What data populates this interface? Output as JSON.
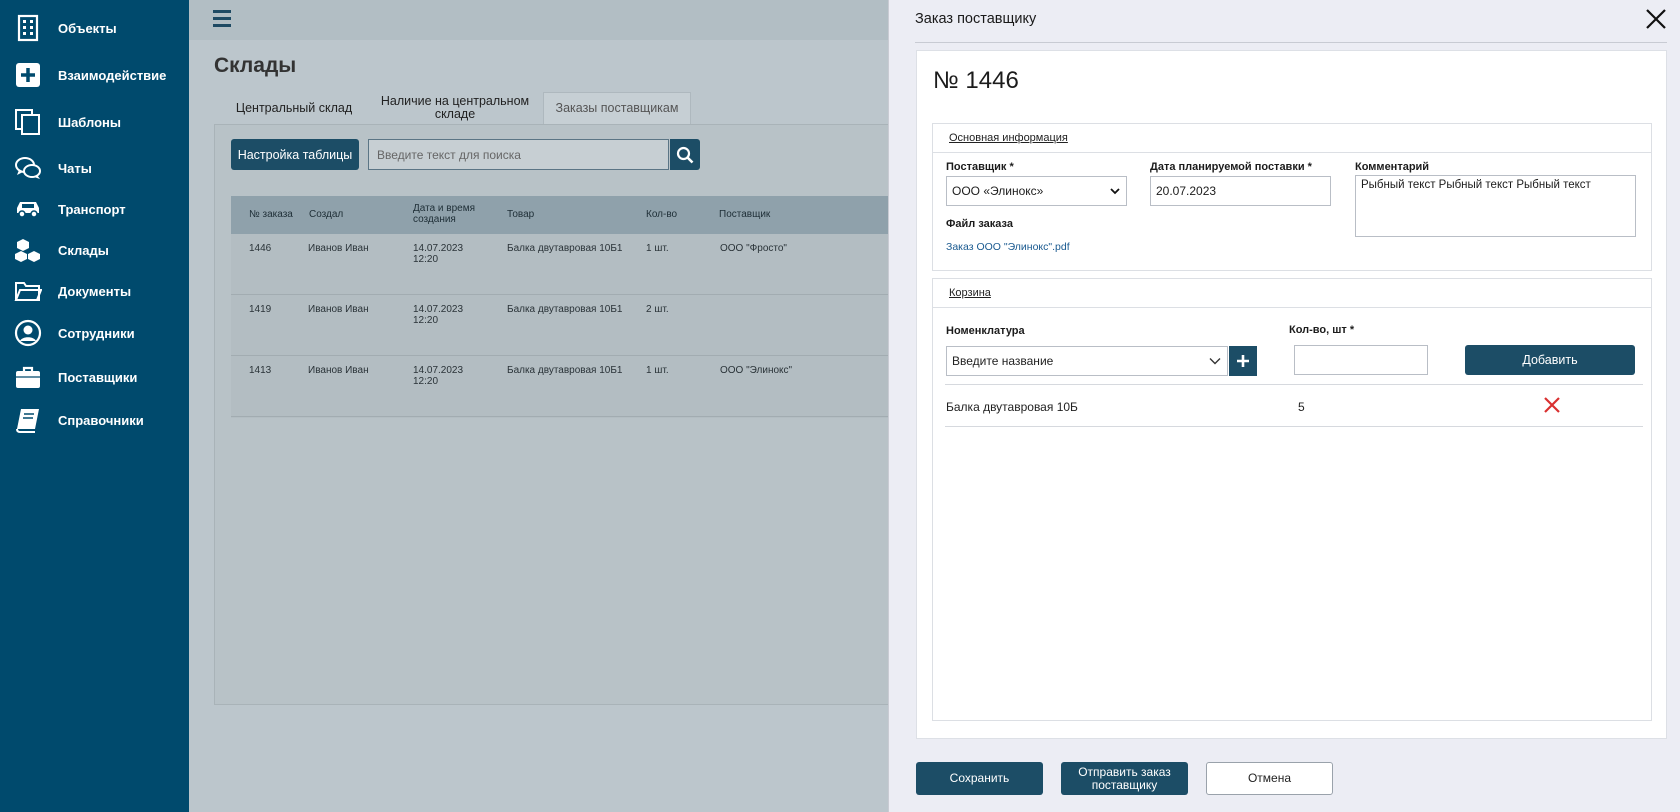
{
  "sidebar": {
    "items": [
      {
        "label": "Объекты",
        "icon": "building-icon"
      },
      {
        "label": "Взаимодействие",
        "icon": "plus-square-icon"
      },
      {
        "label": "Шаблоны",
        "icon": "copy-icon"
      },
      {
        "label": "Чаты",
        "icon": "chat-icon"
      },
      {
        "label": "Транспорт",
        "icon": "car-icon"
      },
      {
        "label": "Склады",
        "icon": "boxes-icon"
      },
      {
        "label": "Документы",
        "icon": "folder-icon"
      },
      {
        "label": "Сотрудники",
        "icon": "user-icon"
      },
      {
        "label": "Поставщики",
        "icon": "briefcase-icon"
      },
      {
        "label": "Справочники",
        "icon": "book-icon"
      }
    ]
  },
  "main": {
    "title": "Склады",
    "tabs": [
      {
        "label": "Центральный склад",
        "active": false
      },
      {
        "label": "Наличие на центральном складе",
        "active": false
      },
      {
        "label": "Заказы поставщикам",
        "active": true
      }
    ],
    "config_button": "Настройка таблицы",
    "search_placeholder": "Введите текст для поиска",
    "table": {
      "columns": [
        "№ заказа",
        "Создал",
        "Дата и время создания",
        "Товар",
        "Кол-во",
        "Поставщик"
      ],
      "rows": [
        {
          "id": "1446",
          "creator": "Иванов Иван",
          "date": "14.07.2023",
          "time": "12:20",
          "product": "Балка двутавровая 10Б1",
          "qty": "1 шт.",
          "supplier": "ООО \"Фросто\""
        },
        {
          "id": "1419",
          "creator": "Иванов Иван",
          "date": "14.07.2023",
          "time": "12:20",
          "product": "Балка двутавровая 10Б1",
          "qty": "2 шт.",
          "supplier": ""
        },
        {
          "id": "1413",
          "creator": "Иванов Иван",
          "date": "14.07.2023",
          "time": "12:20",
          "product": "Балка двутавровая 10Б1",
          "qty": "1 шт.",
          "supplier": "ООО \"Элинокс\""
        }
      ]
    }
  },
  "overlay": {
    "title": "Заказ поставщику",
    "order_number": "№ 1446",
    "info": {
      "section_title": "Основная информация",
      "supplier_label": "Поставщик *",
      "supplier_value": "ООО «Элинокс»",
      "date_label": "Дата планируемой поставки *",
      "date_value": "20.07.2023",
      "comment_label": "Комментарий",
      "comment_value": "Рыбный текст Рыбный текст Рыбный текст",
      "file_label": "Файл заказа",
      "file_link": "Заказ ООО \"Элинокс\".pdf"
    },
    "cart": {
      "section_title": "Корзина",
      "nomenclature_label": "Номенклатура",
      "nomenclature_placeholder": "Введите название",
      "qty_label": "Кол-во, шт *",
      "add_button": "Добавить",
      "items": [
        {
          "name": "Балка двутавровая 10Б",
          "qty": "5"
        }
      ]
    },
    "buttons": {
      "save": "Сохранить",
      "send": "Отправить заказ поставщику",
      "cancel": "Отмена"
    }
  },
  "colors": {
    "sidebar": "#004a6d",
    "accent": "#1c4d66",
    "delete": "#d93030",
    "link": "#1a5a90"
  }
}
